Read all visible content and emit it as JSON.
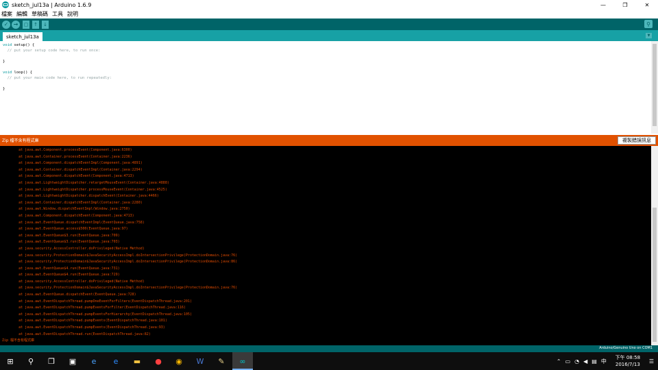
{
  "window": {
    "title": "sketch_jul13a | Arduino 1.6.9",
    "minimize_glyph": "—",
    "maximize_glyph": "❐",
    "close_glyph": "✕"
  },
  "menubar": {
    "items": [
      "檔案",
      "編輯",
      "草稿碼",
      "工具",
      "說明"
    ]
  },
  "toolbar": {
    "verify_glyph": "✓",
    "upload_glyph": "→",
    "new_glyph": "▢",
    "open_glyph": "↑",
    "save_glyph": "↓",
    "serial_monitor_glyph": "⚲"
  },
  "tabs": {
    "active": "sketch_jul13a",
    "menu_glyph": "▼"
  },
  "editor": {
    "lines": [
      {
        "kw": "void",
        "text": " setup() {"
      },
      {
        "kw": "",
        "text": "  // put your setup code here, to run once:",
        "comment": true
      },
      {
        "kw": "",
        "text": ""
      },
      {
        "kw": "",
        "text": "}"
      },
      {
        "kw": "",
        "text": ""
      },
      {
        "kw": "void",
        "text": " loop() {"
      },
      {
        "kw": "",
        "text": "  // put your main code here, to run repeatedly:",
        "comment": true
      },
      {
        "kw": "",
        "text": ""
      },
      {
        "kw": "",
        "text": "}"
      }
    ]
  },
  "status": {
    "message": "Zip 檔不含有程式庫",
    "copy_button": "複製錯誤訊息"
  },
  "console": {
    "lines": [
      "\tat java.awt.Component.processEvent(Component.java:6300)",
      "\tat java.awt.Container.processEvent(Container.java:2236)",
      "\tat java.awt.Component.dispatchEventImpl(Component.java:4891)",
      "\tat java.awt.Container.dispatchEventImpl(Container.java:2294)",
      "\tat java.awt.Component.dispatchEvent(Component.java:4713)",
      "\tat java.awt.LightweightDispatcher.retargetMouseEvent(Container.java:4888)",
      "\tat java.awt.LightweightDispatcher.processMouseEvent(Container.java:4525)",
      "\tat java.awt.LightweightDispatcher.dispatchEvent(Container.java:4466)",
      "\tat java.awt.Container.dispatchEventImpl(Container.java:2280)",
      "\tat java.awt.Window.dispatchEventImpl(Window.java:2750)",
      "\tat java.awt.Component.dispatchEvent(Component.java:4713)",
      "\tat java.awt.EventQueue.dispatchEventImpl(EventQueue.java:758)",
      "\tat java.awt.EventQueue.access$500(EventQueue.java:97)",
      "\tat java.awt.EventQueue$3.run(EventQueue.java:709)",
      "\tat java.awt.EventQueue$3.run(EventQueue.java:703)",
      "\tat java.security.AccessController.doPrivileged(Native Method)",
      "\tat java.security.ProtectionDomain$JavaSecurityAccessImpl.doIntersectionPrivilege(ProtectionDomain.java:76)",
      "\tat java.security.ProtectionDomain$JavaSecurityAccessImpl.doIntersectionPrivilege(ProtectionDomain.java:86)",
      "\tat java.awt.EventQueue$4.run(EventQueue.java:731)",
      "\tat java.awt.EventQueue$4.run(EventQueue.java:729)",
      "\tat java.security.AccessController.doPrivileged(Native Method)",
      "\tat java.security.ProtectionDomain$JavaSecurityAccessImpl.doIntersectionPrivilege(ProtectionDomain.java:76)",
      "\tat java.awt.EventQueue.dispatchEvent(EventQueue.java:728)",
      "\tat java.awt.EventDispatchThread.pumpOneEventForFilters(EventDispatchThread.java:201)",
      "\tat java.awt.EventDispatchThread.pumpEventsForFilter(EventDispatchThread.java:116)",
      "\tat java.awt.EventDispatchThread.pumpEventsForHierarchy(EventDispatchThread.java:105)",
      "\tat java.awt.EventDispatchThread.pumpEvents(EventDispatchThread.java:101)",
      "\tat java.awt.EventDispatchThread.pumpEvents(EventDispatchThread.java:93)",
      "\tat java.awt.EventDispatchThread.run(EventDispatchThread.java:82)",
      "Zip 檔不含有程式庫"
    ]
  },
  "board": {
    "label": "Arduino/Genuino Uno on COM1"
  },
  "taskbar": {
    "start_glyph": "⊞",
    "search_glyph": "⚲",
    "taskview_glyph": "❐",
    "store_glyph": "▣",
    "ie_glyph": "e",
    "edge_glyph": "e",
    "explorer_glyph": "▬",
    "media_glyph": "●",
    "chrome_glyph": "◉",
    "word_glyph": "W",
    "notepad_glyph": "✎",
    "arduino_glyph": "∞",
    "tray_up_glyph": "⌃",
    "battery_glyph": "▭",
    "network_glyph": "◔",
    "volume_glyph": "◀",
    "action_glyph": "▤",
    "ime_label": "中",
    "time": "下午 08:58",
    "date": "2016/7/13",
    "notifications_glyph": "☰"
  },
  "colors": {
    "toolbar": "#006468",
    "tabbar": "#17a1a5",
    "status_error": "#e15100",
    "console_text": "#e34c00"
  }
}
